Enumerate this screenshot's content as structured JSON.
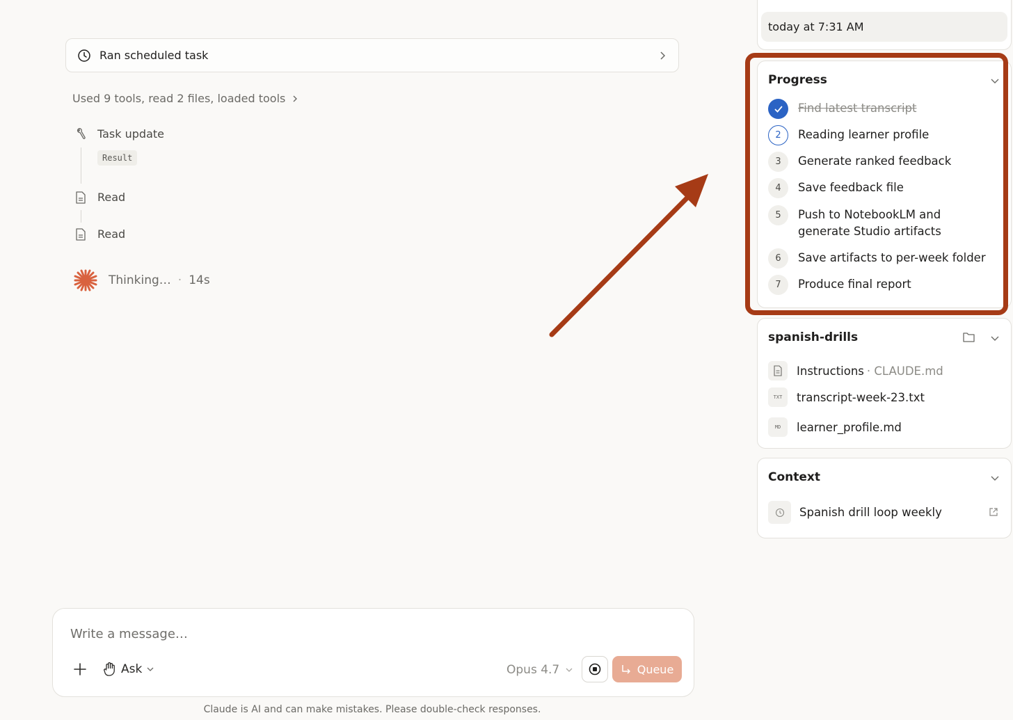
{
  "main": {
    "scheduled_task_label": "Ran scheduled task",
    "tools_summary": "Used 9 tools, read 2 files, loaded tools",
    "timeline": [
      {
        "label": "Task update",
        "chip": "Result",
        "icon": "wrench-icon"
      },
      {
        "label": "Read",
        "icon": "document-icon"
      },
      {
        "label": "Read",
        "icon": "document-icon"
      }
    ],
    "thinking_label": "Thinking…",
    "thinking_time": "14s"
  },
  "composer": {
    "placeholder": "Write a message…",
    "mode_label": "Ask",
    "model_label": "Opus 4.7",
    "queue_label": "Queue"
  },
  "disclaimer": "Claude is AI and can make mistakes. Please double-check responses.",
  "sidebar": {
    "date_label": "today at 7:31 AM",
    "progress": {
      "title": "Progress",
      "steps": [
        {
          "num": "1",
          "label": "Find latest transcript",
          "state": "done"
        },
        {
          "num": "2",
          "label": "Reading learner profile",
          "state": "active"
        },
        {
          "num": "3",
          "label": "Generate ranked feedback",
          "state": "pending"
        },
        {
          "num": "4",
          "label": "Save feedback file",
          "state": "pending"
        },
        {
          "num": "5",
          "label": "Push to NotebookLM and generate Studio artifacts",
          "state": "pending"
        },
        {
          "num": "6",
          "label": "Save artifacts to per-week folder",
          "state": "pending"
        },
        {
          "num": "7",
          "label": "Produce final report",
          "state": "pending"
        }
      ]
    },
    "project": {
      "title": "spanish-drills",
      "files": [
        {
          "name": "Instructions",
          "suffix": "· CLAUDE.md",
          "icon_tag": ""
        },
        {
          "name": "transcript-week-23.txt",
          "icon_tag": "TXT"
        },
        {
          "name": "learner_profile.md",
          "icon_tag": "MD"
        }
      ]
    },
    "context": {
      "title": "Context",
      "item": "Spanish drill loop weekly"
    }
  },
  "colors": {
    "accent_blue": "#2b63c4",
    "highlight": "#a63b16",
    "queue_button": "#e8ab94",
    "spark": "#d9623f"
  }
}
